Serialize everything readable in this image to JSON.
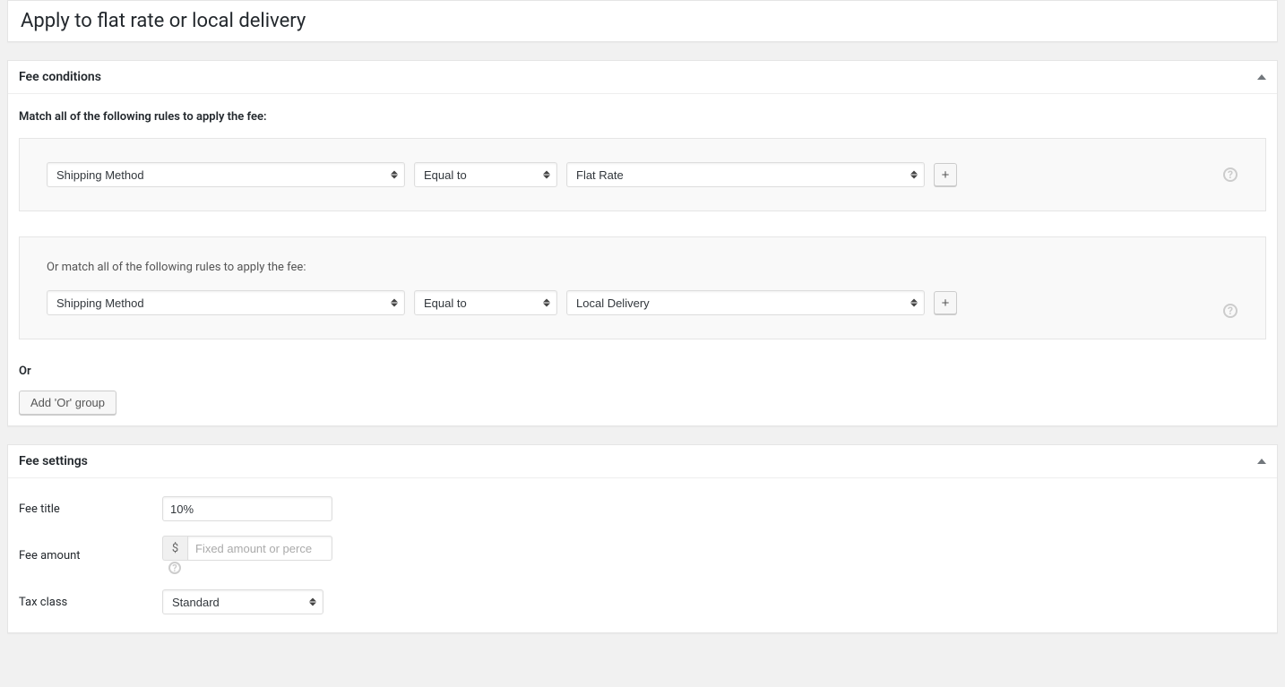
{
  "title": "Apply to flat rate or local delivery",
  "fee_conditions": {
    "header": "Fee conditions",
    "match_label": "Match all of the following rules to apply the fee:",
    "groups": [
      {
        "label": "",
        "rules": [
          {
            "field": "Shipping Method",
            "operator": "Equal to",
            "value": "Flat Rate"
          }
        ]
      },
      {
        "label": "Or match all of the following rules to apply the fee:",
        "rules": [
          {
            "field": "Shipping Method",
            "operator": "Equal to",
            "value": "Local Delivery"
          }
        ]
      }
    ],
    "or_label": "Or",
    "add_or_group_btn": "Add 'Or' group",
    "plus_label": "+"
  },
  "fee_settings": {
    "header": "Fee settings",
    "rows": {
      "fee_title_label": "Fee title",
      "fee_title_value": "10%",
      "fee_amount_label": "Fee amount",
      "fee_amount_currency": "$",
      "fee_amount_placeholder": "Fixed amount or perce",
      "fee_amount_value": "",
      "tax_class_label": "Tax class",
      "tax_class_value": "Standard"
    }
  }
}
